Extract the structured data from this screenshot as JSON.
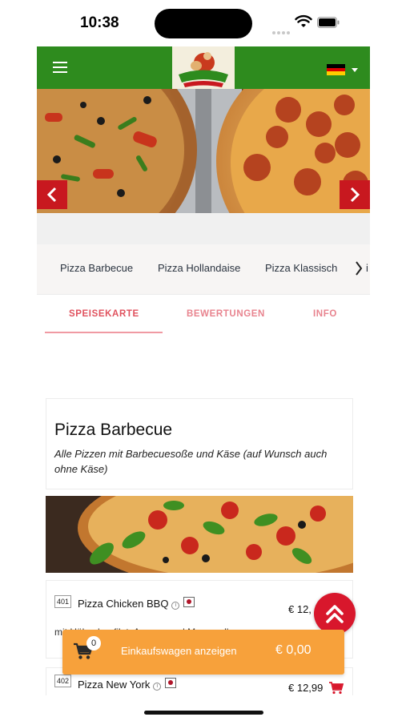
{
  "status_bar": {
    "time": "10:38"
  },
  "header": {
    "logo_alt": "Restaurant DHILLON",
    "language_flag": "de"
  },
  "categories": [
    {
      "label": "Pizza Barbecue"
    },
    {
      "label": "Pizza Hollandaise"
    },
    {
      "label": "Pizza Klassisch"
    }
  ],
  "category_overflow": "i",
  "tabs": [
    {
      "label": "SPEISEKARTE",
      "active": true
    },
    {
      "label": "BEWERTUNGEN",
      "active": false
    },
    {
      "label": "INFO",
      "active": false
    }
  ],
  "section": {
    "title": "Pizza Barbecue",
    "description": "Alle Pizzen mit Barbecuesoße und Käse (auf Wunsch auch ohne Käse)"
  },
  "items": [
    {
      "number": "401",
      "name": "Pizza Chicken BBQ",
      "price": "€ 12,",
      "description": "mit Hähnchenfilet, Ananas und Mozzarella"
    },
    {
      "number": "402",
      "name": "Pizza New York",
      "price": "€ 12,99"
    }
  ],
  "cart": {
    "count": "0",
    "label": "Einkaufswagen anzeigen",
    "total": "€ 0,00"
  },
  "colors": {
    "brand_green": "#2e8b1e",
    "accent_red": "#d8172c",
    "cart_orange": "#f7a13b",
    "tab_pink": "#e0525e"
  }
}
